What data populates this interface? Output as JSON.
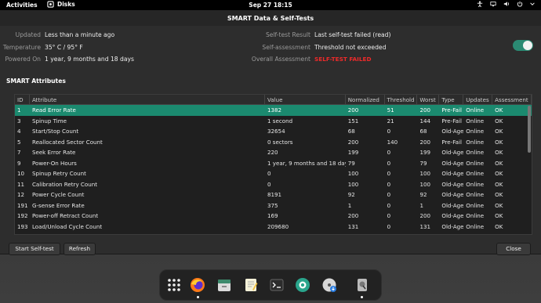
{
  "topbar": {
    "activities": "Activities",
    "app_name": "Disks",
    "clock": "Sep 27  18:15"
  },
  "dialog": {
    "title": "SMART Data & Self-Tests"
  },
  "info": {
    "updated_label": "Updated",
    "updated_value": "Less than a minute ago",
    "temperature_label": "Temperature",
    "temperature_value": "35° C / 95° F",
    "powered_on_label": "Powered On",
    "powered_on_value": "1 year, 9 months and 18 days",
    "self_test_label": "Self-test Result",
    "self_test_value": "Last self-test failed (read)",
    "self_assessment_label": "Self-assessment",
    "self_assessment_value": "Threshold not exceeded",
    "overall_label": "Overall Assessment",
    "overall_value": "SELF-TEST FAILED"
  },
  "smart_enabled": true,
  "attributes_heading": "SMART Attributes",
  "table": {
    "columns": [
      "ID",
      "Attribute",
      "Value",
      "Normalized",
      "Threshold",
      "Worst",
      "Type",
      "Updates",
      "Assessment"
    ],
    "rows": [
      [
        "1",
        "Read Error Rate",
        "1382",
        "200",
        "51",
        "200",
        "Pre-Fail",
        "Online",
        "OK"
      ],
      [
        "3",
        "Spinup Time",
        "1 second",
        "151",
        "21",
        "144",
        "Pre-Fail",
        "Online",
        "OK"
      ],
      [
        "4",
        "Start/Stop Count",
        "32654",
        "68",
        "0",
        "68",
        "Old-Age",
        "Online",
        "OK"
      ],
      [
        "5",
        "Reallocated Sector Count",
        "0 sectors",
        "200",
        "140",
        "200",
        "Pre-Fail",
        "Online",
        "OK"
      ],
      [
        "7",
        "Seek Error Rate",
        "220",
        "199",
        "0",
        "199",
        "Old-Age",
        "Online",
        "OK"
      ],
      [
        "9",
        "Power-On Hours",
        "1 year, 9 months and 18 days",
        "79",
        "0",
        "79",
        "Old-Age",
        "Online",
        "OK"
      ],
      [
        "10",
        "Spinup Retry Count",
        "0",
        "100",
        "0",
        "100",
        "Old-Age",
        "Online",
        "OK"
      ],
      [
        "11",
        "Calibration Retry Count",
        "0",
        "100",
        "0",
        "100",
        "Old-Age",
        "Online",
        "OK"
      ],
      [
        "12",
        "Power Cycle Count",
        "8191",
        "92",
        "0",
        "92",
        "Old-Age",
        "Online",
        "OK"
      ],
      [
        "191",
        "G-sense Error Rate",
        "375",
        "1",
        "0",
        "1",
        "Old-Age",
        "Online",
        "OK"
      ],
      [
        "192",
        "Power-off Retract Count",
        "169",
        "200",
        "0",
        "200",
        "Old-Age",
        "Online",
        "OK"
      ],
      [
        "193",
        "Load/Unload Cycle Count",
        "209680",
        "131",
        "0",
        "131",
        "Old-Age",
        "Online",
        "OK"
      ]
    ],
    "selected_row": 0
  },
  "buttons": {
    "start": "Start Self-test",
    "refresh": "Refresh",
    "close": "Close"
  },
  "dock": [
    "app-grid-icon",
    "firefox-icon",
    "files-icon",
    "text-editor-icon",
    "terminal-icon",
    "camera-aperture-icon",
    "disc-install-icon",
    "disk-utility-icon"
  ],
  "colors": {
    "accent": "#1b8a6f",
    "failed": "#ee2a2a"
  }
}
